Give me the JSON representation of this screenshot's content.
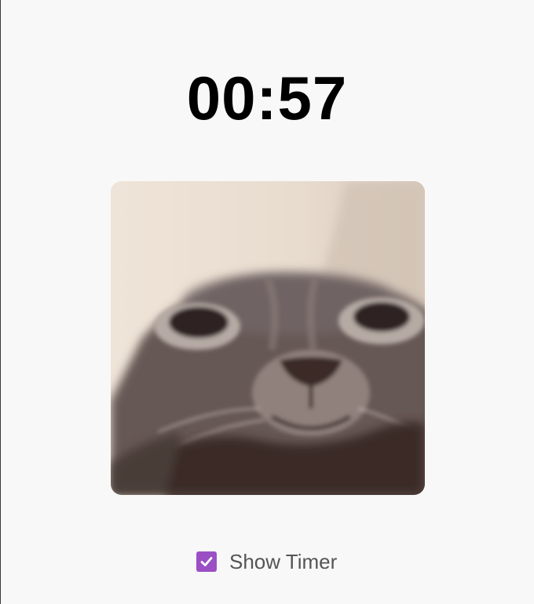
{
  "timer": {
    "display": "00:57"
  },
  "image": {
    "subject_icon": "cat-face-photo"
  },
  "controls": {
    "show_timer_label": "Show Timer",
    "show_timer_checked": true,
    "checkbox_color": "#9b4fc4"
  },
  "colors": {
    "page_background": "#f8f8f8",
    "timer_text": "#000000",
    "label_text": "#555555"
  }
}
